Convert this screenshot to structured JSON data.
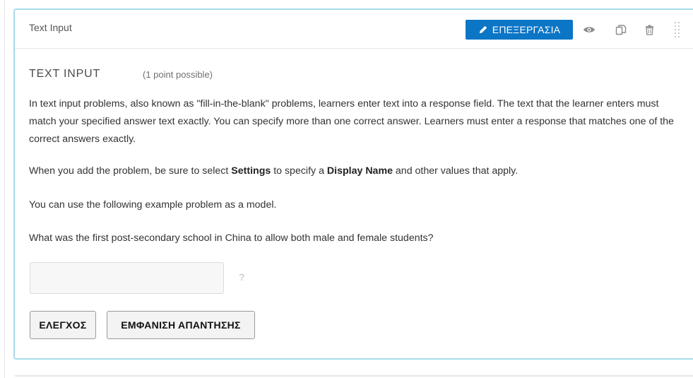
{
  "component": {
    "header_title": "Text Input",
    "edit_label": "ΕΠΕΞΕΡΓΑΣΙΑ",
    "accent_color": "#0b75c6",
    "border_color": "#a6dbe9",
    "icons": {
      "edit": "pencil-icon",
      "preview": "eye-icon",
      "duplicate": "duplicate-icon",
      "delete": "trash-icon",
      "drag": "drag-handle-icon"
    }
  },
  "problem": {
    "title": "TEXT INPUT",
    "points": "(1 point possible)",
    "paragraph1": "In text input problems, also known as \"fill-in-the-blank\" problems, learners enter text into a response field. The text that the learner enters must match your specified answer text exactly. You can specify more than one correct answer. Learners must enter a response that matches one of the correct answers exactly.",
    "paragraph2_parts": {
      "a": "When you add the problem, be sure to select ",
      "b": "Settings",
      "c": " to specify a ",
      "d": "Display Name",
      "e": " and other values that apply."
    },
    "paragraph3": "You can use the following example problem as a model.",
    "question": "What was the first post-secondary school in China to allow both male and female students?",
    "answer": {
      "value": "",
      "help_symbol": "?"
    },
    "check_label": "ΕΛΕΓΧΟΣ",
    "show_answer_label": "ΕΜΦΑΝΙΣΗ ΑΠΑΝΤΗΣΗΣ"
  }
}
